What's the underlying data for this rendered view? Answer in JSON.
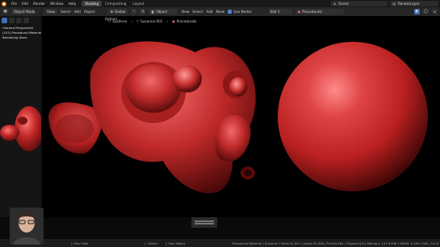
{
  "topbar": {
    "menu": [
      "File",
      "Edit",
      "Render",
      "Window",
      "Help"
    ],
    "workspaces": [
      {
        "label": "Shading",
        "active": true
      },
      {
        "label": "Compositing",
        "active": false
      },
      {
        "label": "Layout",
        "active": false
      }
    ],
    "scene_label": "Scene",
    "viewlayer_label": "RenderLayer"
  },
  "left_header": {
    "mode_label": "Object Mode"
  },
  "viewport_header": {
    "orientation": "Global",
    "mode_label": "Object",
    "menu": [
      "View",
      "Select",
      "Add",
      "Object"
    ],
    "view_menu": [
      "View",
      "Select",
      "Add",
      "Node"
    ],
    "use_nodes": "Use Nodes",
    "slot": "Slot 1",
    "material": "Proceduralz",
    "options": "Options"
  },
  "breadcrumb": [
    "Suzanne",
    "Suzanne.001",
    "Proceduralz"
  ],
  "left_pane": {
    "line1": "Camera Perspective",
    "line2": "(101) Procedural Material",
    "line3": "Rendering Done"
  },
  "status": {
    "left": "Pan View",
    "select": "Select",
    "box_select": "Box Select",
    "stats": "Procedural Material | Suzanne | Verts:41,991 | Faces:32,838 | Tris:83,584 | Objects:0/4 | Memory: 147.9 MiB | VRAM: 3.1/6.0 GiB | 3.0.0"
  },
  "colors": {
    "accent_orange": "#e87d0d",
    "selection_blue": "#4a7fd1",
    "material_red": "#c92a2a"
  }
}
